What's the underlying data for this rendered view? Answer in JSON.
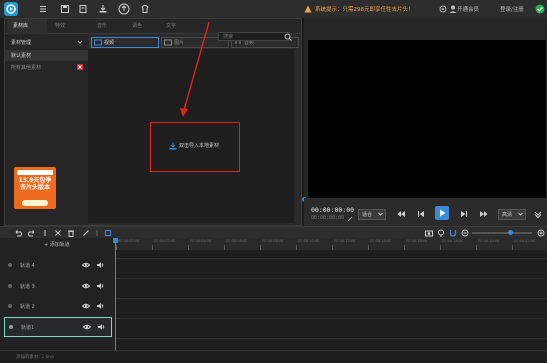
{
  "topbar": {
    "notice": "系统提示：只需298元即享任性去片头！",
    "right_items": [
      "开通会员",
      "登录/注册"
    ],
    "icons": [
      "app-logo",
      "menu-icon",
      "save-icon",
      "new-project-icon",
      "export-icon",
      "upload-icon",
      "skin-icon"
    ]
  },
  "library": {
    "tabs": [
      "素材库",
      "特效",
      "音乐",
      "调色",
      "文字"
    ],
    "active_tab": "素材库",
    "sidebar_header": "素材管理",
    "sidebar_items": [
      "默认素材",
      "所有其他素材"
    ],
    "categories": [
      "视频",
      "图片",
      "音频"
    ],
    "search_placeholder": "搜索",
    "import_label": "双击导入本地素材",
    "ad_text": "13.9元包季 去片头版本"
  },
  "player": {
    "timecode": "00:00:00:00",
    "timecode_total": "00:00:00:00",
    "fit_label": "适合",
    "quality_label": "高清"
  },
  "timeline": {
    "add_track_label": "添加轨道",
    "ruler_ticks": [
      "00:00:00:00",
      "00:00:02:00",
      "00:00:04:00",
      "00:00:06:00",
      "00:00:08:00",
      "00:00:10:00",
      "00:00:12:00",
      "00:00:14:00",
      "00:00:16:00",
      "00:00:18:00",
      "00:00:20:00",
      "00:00:22:00"
    ],
    "tracks": [
      {
        "label": "轨道 4"
      },
      {
        "label": "轨道 3"
      },
      {
        "label": "轨道 2"
      },
      {
        "label": "轨道1",
        "selected": true
      }
    ],
    "status": "添加的素材: 1 line"
  },
  "colors": {
    "accent": "#3a8ad8",
    "highlight": "#e0241b",
    "selected_track": "#7ed8d0"
  }
}
